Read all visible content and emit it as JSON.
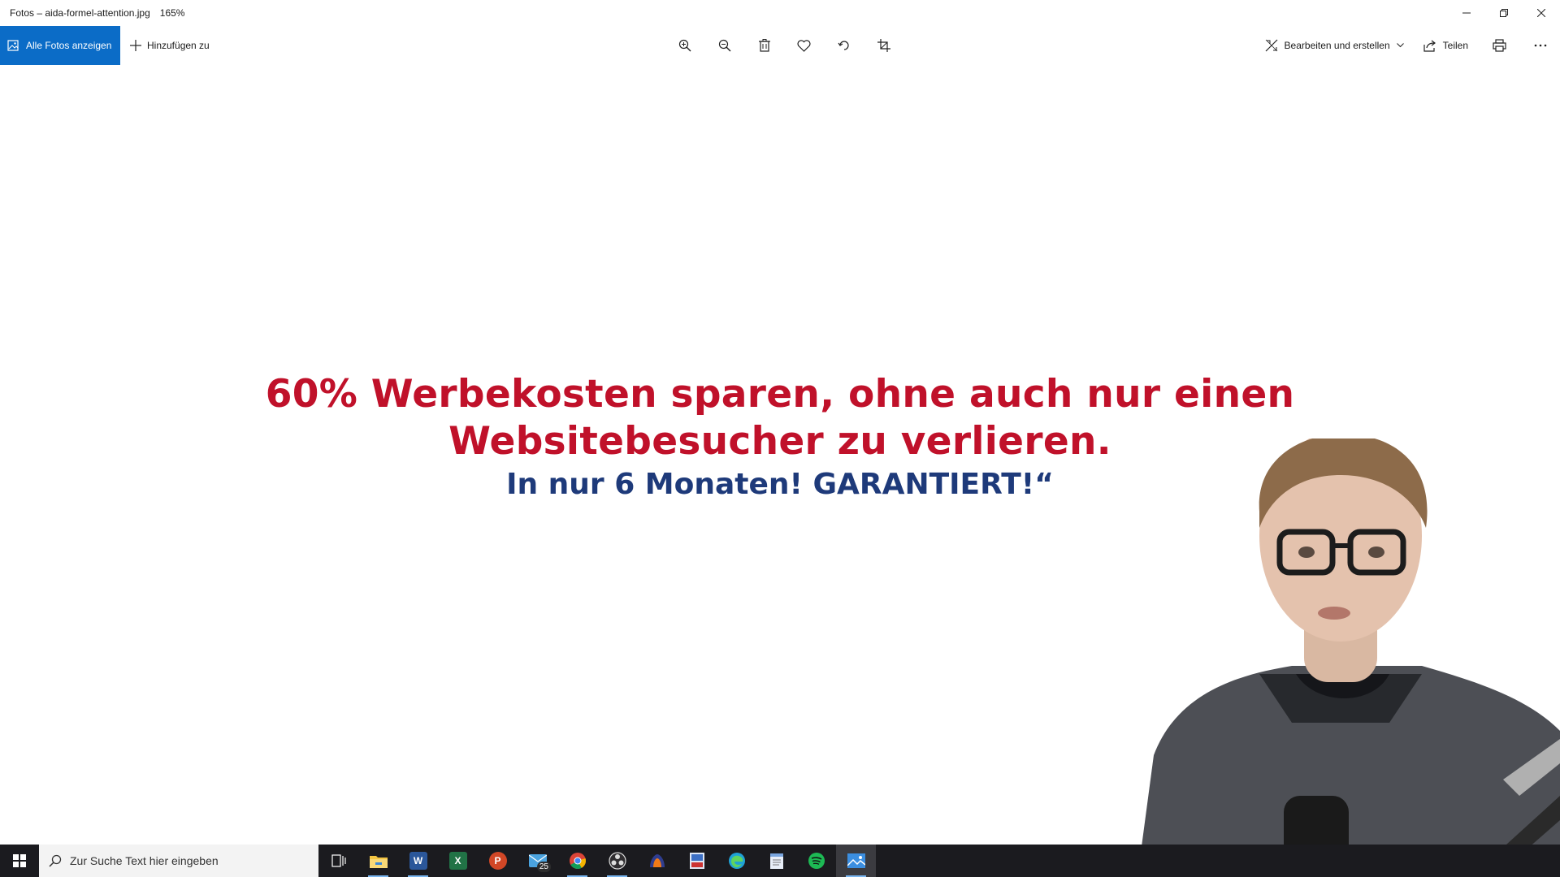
{
  "window": {
    "title": "Fotos – aida-formel-attention.jpg",
    "zoom": "165%"
  },
  "toolbar": {
    "all_photos_label": "Alle Fotos anzeigen",
    "add_to_label": "Hinzufügen zu",
    "edit_label": "Bearbeiten und erstellen",
    "share_label": "Teilen",
    "center_icons": [
      "zoom-in-icon",
      "zoom-out-icon",
      "delete-icon",
      "heart-icon",
      "rotate-icon",
      "crop-icon"
    ]
  },
  "image": {
    "line1": "60% Werbekosten sparen, ohne auch nur einen",
    "line2": "Websitebesucher zu verlieren.",
    "line3": "In nur 6 Monaten! GARANTIERT!“",
    "colors": {
      "headline": "#c0112a",
      "subline": "#1e3a7a"
    }
  },
  "taskbar": {
    "search_placeholder": "Zur Suche Text hier eingeben",
    "mail_badge": "25",
    "apps": [
      "task-view",
      "file-explorer",
      "word",
      "excel",
      "powerpoint",
      "mail",
      "chrome",
      "obs",
      "app-orange",
      "image-editor",
      "edge",
      "notepad",
      "spotify",
      "photos"
    ]
  },
  "accent": "#0b6cc7"
}
